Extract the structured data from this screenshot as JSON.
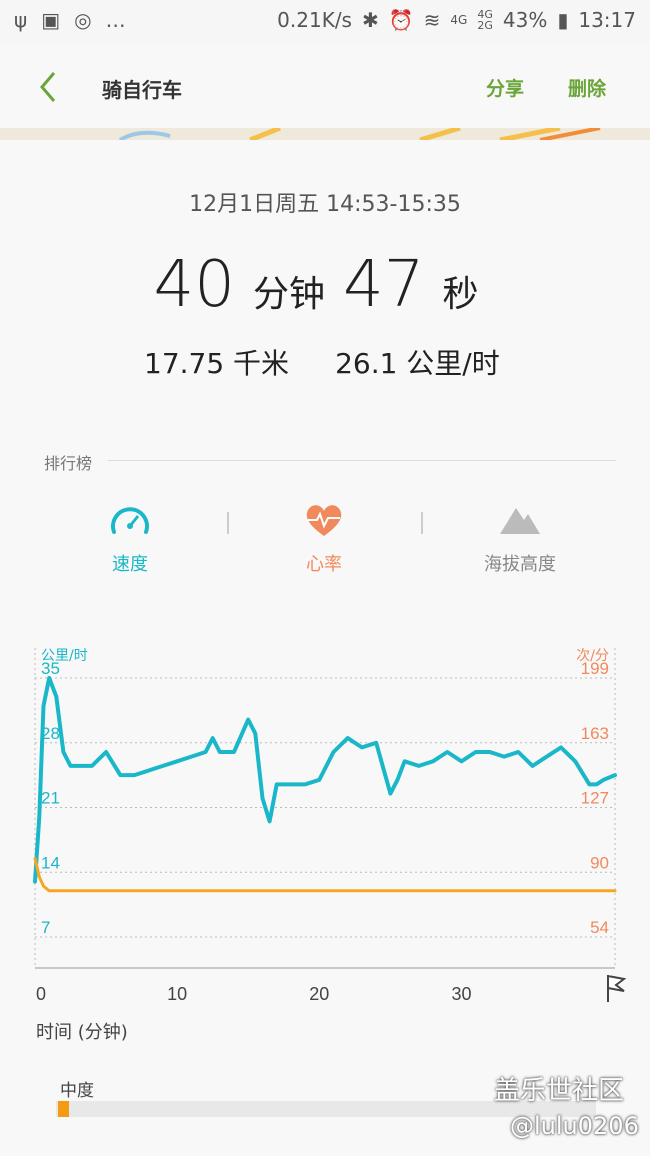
{
  "status": {
    "net_speed": "0.21K/s",
    "battery": "43%",
    "time": "13:17",
    "net1": "4G",
    "net2": "4G",
    "net3": "2G"
  },
  "appbar": {
    "title": "骑自行车",
    "share": "分享",
    "delete": "删除"
  },
  "session": {
    "date": "12月1日周五 14:53-15:35",
    "minutes": "40",
    "min_unit": "分钟",
    "seconds": "47",
    "sec_unit": "秒",
    "distance": "17.75 千米",
    "speed": "26.1 公里/时"
  },
  "ranking": {
    "label": "排行榜"
  },
  "tabs": [
    {
      "label": "速度",
      "color": "#1ab7c9"
    },
    {
      "label": "心率",
      "color": "#f08a5d"
    },
    {
      "label": "海拔高度",
      "color": "#999999"
    }
  ],
  "chart_data": {
    "type": "line",
    "left_unit": "公里/时",
    "right_unit": "次/分",
    "left_ticks": [
      "35",
      "28",
      "21",
      "14",
      "7"
    ],
    "right_ticks": [
      "199",
      "163",
      "127",
      "90",
      "54"
    ],
    "x_ticks": [
      "0",
      "10",
      "20",
      "30"
    ],
    "xlabel": "时间 (分钟)",
    "xlim": [
      0,
      40.8
    ],
    "ylim": [
      7,
      35
    ],
    "series": [
      {
        "name": "速度",
        "color": "#1ab7c9",
        "x": [
          0,
          0.3,
          0.6,
          1,
          1.5,
          2,
          2.5,
          3,
          4,
          5,
          6,
          7,
          8,
          9,
          10,
          11,
          12,
          12.5,
          13,
          14,
          15,
          15.5,
          16,
          16.5,
          17,
          18,
          19,
          20,
          21,
          22,
          23,
          24,
          25,
          25.5,
          26,
          27,
          28,
          29,
          30,
          31,
          32,
          33,
          34,
          35,
          36,
          37,
          38,
          39,
          39.5,
          40,
          40.8
        ],
        "y": [
          13,
          20,
          32,
          35,
          33,
          27,
          25.5,
          25.5,
          25.5,
          27,
          24.5,
          24.5,
          25,
          25.5,
          26,
          26.5,
          27,
          28.5,
          27,
          27,
          30.5,
          29,
          22,
          19.5,
          23.5,
          23.5,
          23.5,
          24,
          27,
          28.5,
          27.5,
          28,
          22.5,
          24,
          26,
          25.5,
          26,
          27,
          26,
          27,
          27,
          26.5,
          27,
          25.5,
          26.5,
          27.5,
          26,
          23.5,
          23.5,
          24,
          24.5
        ]
      },
      {
        "name": "心率",
        "color": "#f5a623",
        "x": [
          0,
          0.3,
          0.6,
          1,
          2,
          3,
          5,
          10,
          20,
          30,
          40.8
        ],
        "y": [
          15.5,
          13.5,
          12.5,
          12,
          12,
          12,
          12,
          12,
          12,
          12,
          12
        ]
      }
    ]
  },
  "moderate": {
    "label": "中度",
    "fraction": 0.02
  },
  "watermark": {
    "line1": "盖乐世社区",
    "line2": "@lulu0206"
  }
}
